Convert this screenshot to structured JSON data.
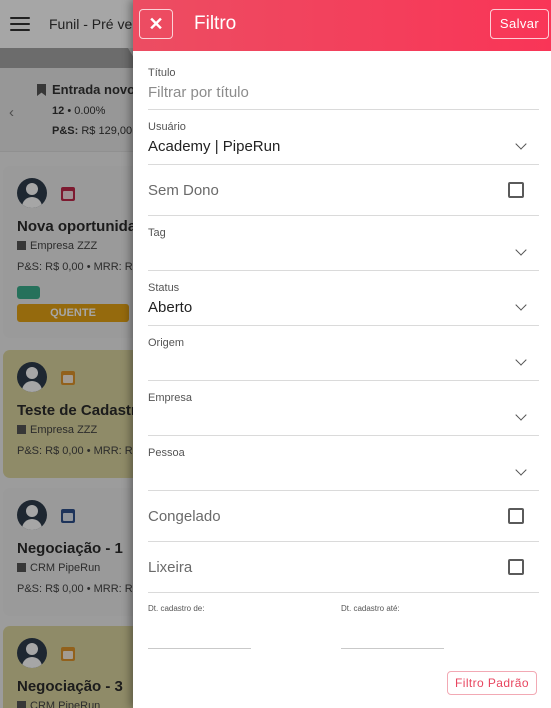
{
  "app": {
    "title": "Funil - Pré ven",
    "stage": {
      "name": "Entrada novo",
      "count": "12",
      "percent": "• 0.00%",
      "sum_label": "P&S:",
      "sum_value": "R$ 129,00"
    },
    "cards": [
      {
        "title": "Nova oportunida",
        "company": "Empresa ZZZ",
        "money": "P&S: R$ 0,00 • MRR: R",
        "calendar_color": "#c0284a",
        "bg": "#ededed",
        "tag": "QUENTE"
      },
      {
        "title": "Teste de Cadastr",
        "company": "Empresa ZZZ",
        "money": "P&S: R$ 0,00 • MRR: R",
        "calendar_color": "#e0952c",
        "bg": "#dcd6a0"
      },
      {
        "title": "Negociação - 1",
        "company": "CRM PipeRun",
        "money": "P&S: R$ 0,00 • MRR: R",
        "calendar_color": "#2d4f8a",
        "bg": "#ededed"
      },
      {
        "title": "Negociação - 3",
        "company": "CRM PipeRun",
        "money": "",
        "calendar_color": "#e0952c",
        "bg": "#dcd6a0"
      }
    ]
  },
  "filter": {
    "title": "Filtro",
    "close_label": "✕",
    "save_label": "Salvar",
    "titulo": {
      "label": "Título",
      "placeholder": "Filtrar por título"
    },
    "usuario": {
      "label": "Usuário",
      "value": "Academy | PipeRun"
    },
    "sem_dono": {
      "label": "Sem Dono",
      "checked": false
    },
    "tag": {
      "label": "Tag",
      "value": ""
    },
    "status": {
      "label": "Status",
      "value": "Aberto"
    },
    "origem": {
      "label": "Origem",
      "value": ""
    },
    "empresa": {
      "label": "Empresa",
      "value": ""
    },
    "pessoa": {
      "label": "Pessoa",
      "value": ""
    },
    "congelado": {
      "label": "Congelado",
      "checked": false
    },
    "lixeira": {
      "label": "Lixeira",
      "checked": false
    },
    "dt_cadastro_de": {
      "label": "Dt. cadastro de:"
    },
    "dt_cadastro_ate": {
      "label": "Dt. cadastro até:"
    },
    "default_label": "Filtro Padrão"
  },
  "colors": {
    "header_start": "#ec4d62",
    "header_end": "#f93557",
    "accent": "#e8455f"
  }
}
